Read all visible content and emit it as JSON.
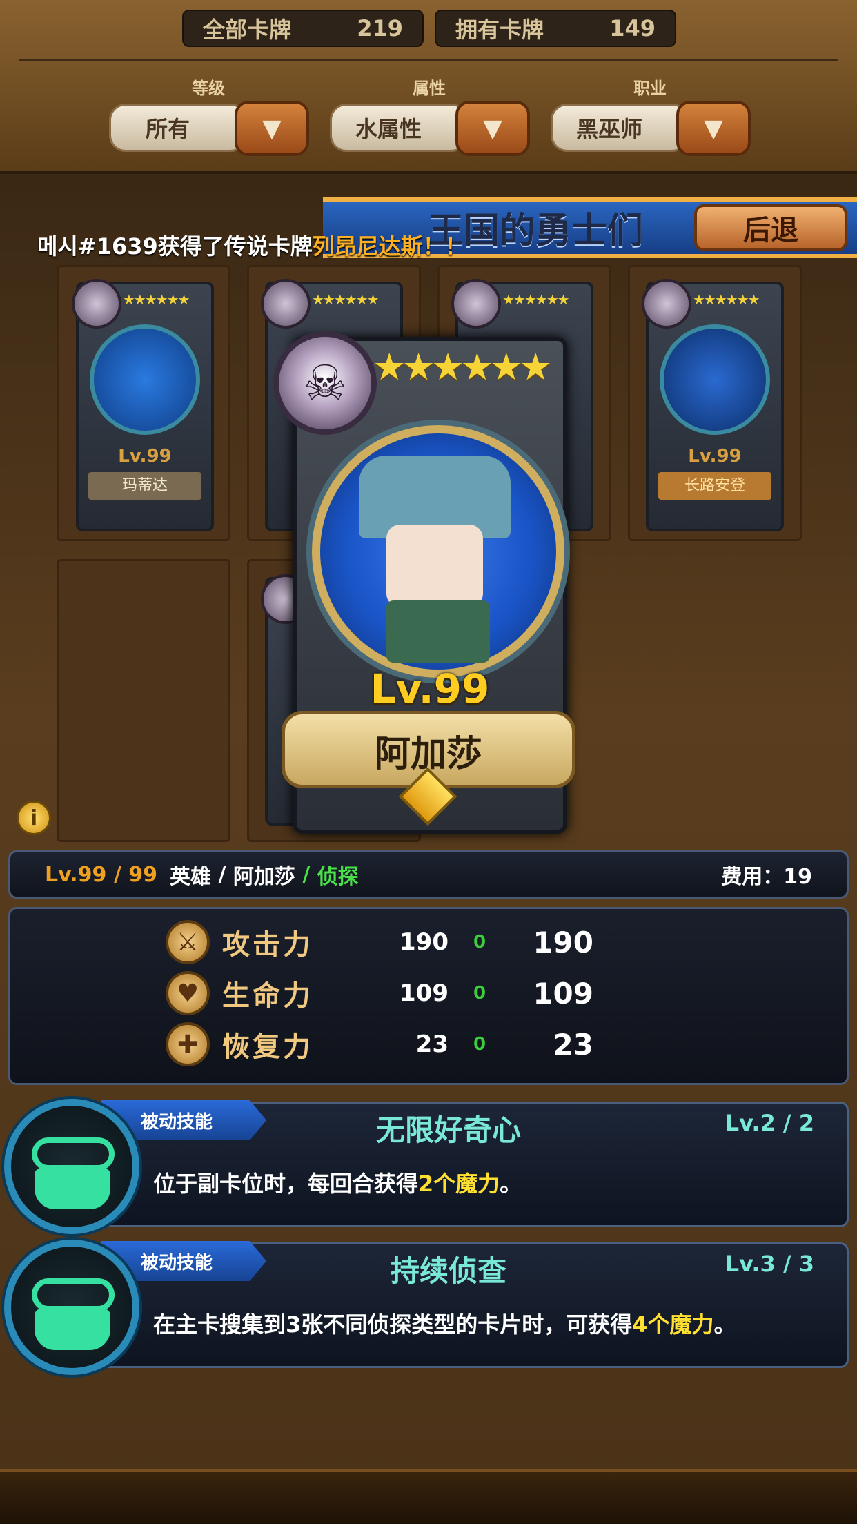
{
  "header": {
    "all_cards_label": "全部卡牌",
    "all_cards_count": "219",
    "owned_cards_label": "拥有卡牌",
    "owned_cards_count": "149"
  },
  "filters": [
    {
      "label": "等级",
      "value": "所有"
    },
    {
      "label": "属性",
      "value": "水属性"
    },
    {
      "label": "职业",
      "value": "黑巫师"
    }
  ],
  "banner": {
    "title": "王国的勇士们",
    "back_label": "后退"
  },
  "announcement": {
    "prefix": "메시#1639获得了传说卡牌",
    "highlight": "列昂尼达斯！！"
  },
  "grid_cards": [
    {
      "level": "Lv.99",
      "name": "玛蒂达"
    },
    {
      "level": "Lv.99",
      "name": "长路安登"
    }
  ],
  "selected_card": {
    "stars": "★★★★★★",
    "level": "Lv.99",
    "name": "阿加莎"
  },
  "info_strip": {
    "level": "Lv.99 / 99",
    "type": "英雄",
    "sep1": " / ",
    "name": "阿加莎",
    "sep2": " / ",
    "class": "侦探",
    "cost": "费用：19"
  },
  "stats": [
    {
      "icon": "sword-icon",
      "name": "攻击力",
      "base": "190",
      "bonus": "0",
      "total": "190"
    },
    {
      "icon": "heart-icon",
      "name": "生命力",
      "base": "109",
      "bonus": "0",
      "total": "109"
    },
    {
      "icon": "cross-icon",
      "name": "恢复力",
      "base": "23",
      "bonus": "0",
      "total": "23"
    }
  ],
  "skills": [
    {
      "tag": "被动技能",
      "name": "无限好奇心",
      "level": "Lv.2 / 2",
      "desc_a": "位于副卡位时，每回合获得",
      "desc_b": "2个魔力",
      "desc_c": "。"
    },
    {
      "tag": "被动技能",
      "name": "持续侦查",
      "level": "Lv.3 / 3",
      "desc_a": "在主卡搜集到3张不同侦探类型的卡片时，可获得",
      "desc_b": "4个魔力",
      "desc_c": "。"
    }
  ],
  "colors": {
    "accent_gold": "#ffcc22",
    "skill_cyan": "#7ae8d8",
    "bonus_green": "#3ad03a",
    "banner_blue": "#2a66c0"
  }
}
